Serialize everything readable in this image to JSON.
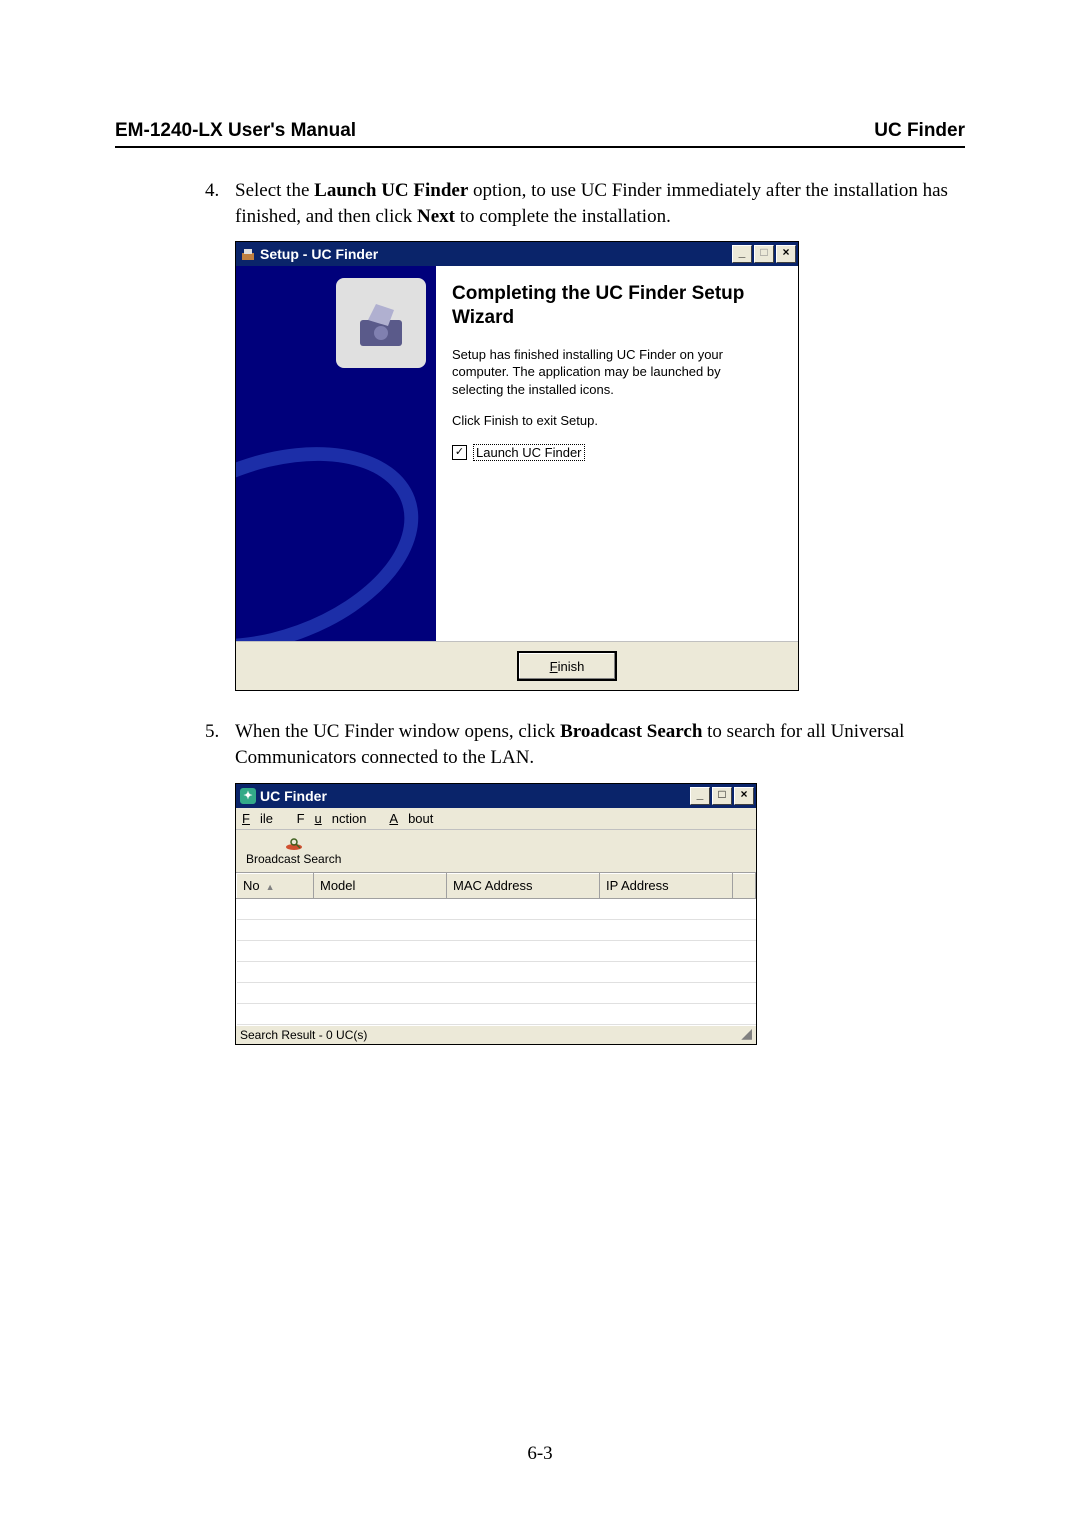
{
  "header": {
    "left": "EM-1240-LX User's Manual",
    "right": "UC Finder"
  },
  "step4": {
    "num": "4.",
    "pre": "Select the ",
    "bold1": "Launch UC Finder",
    "mid": " option, to use UC Finder immediately after the installation has finished, and then click ",
    "bold2": "Next",
    "post": " to complete the installation."
  },
  "wizard": {
    "title": "Setup - UC Finder",
    "heading": "Completing the UC Finder Setup Wizard",
    "para1": "Setup has finished installing UC Finder on your computer. The application may be launched by selecting the installed icons.",
    "para2": "Click Finish to exit Setup.",
    "check_label": "Launch UC Finder",
    "finish_u": "F",
    "finish_rest": "inish",
    "btn_min": "_",
    "btn_max": "□",
    "btn_close": "×"
  },
  "step5": {
    "num": "5.",
    "pre": "When the UC Finder window opens, click ",
    "bold1": "Broadcast Search",
    "post": " to search for all Universal Communicators connected to the LAN."
  },
  "finder": {
    "title": "UC Finder",
    "menu": {
      "file_u": "F",
      "file_rest": "ile",
      "func_pre": "F",
      "func_u": "u",
      "func_rest": "nction",
      "about_u": "A",
      "about_rest": "bout"
    },
    "toolbar": {
      "broadcast": "Broadcast Search"
    },
    "cols": {
      "no": "No",
      "model": "Model",
      "mac": "MAC Address",
      "ip": "IP Address"
    },
    "status": "Search Result - 0 UC(s)",
    "btn_min": "_",
    "btn_max": "□",
    "btn_close": "×"
  },
  "page_number": "6-3"
}
